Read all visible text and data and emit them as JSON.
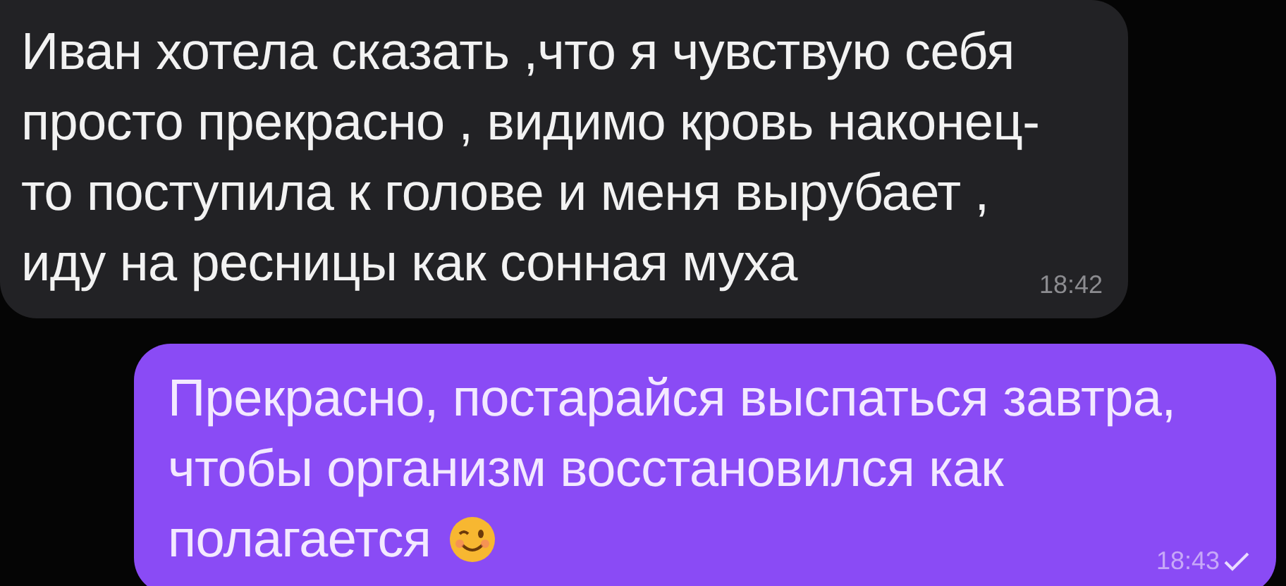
{
  "messages": [
    {
      "kind": "incoming",
      "lines": [
        "Иван хотела сказать ,что я чувствую себя",
        "просто прекрасно , видимо кровь наконец-",
        "то поступила к голове и меня вырубает ,",
        "иду на ресницы как сонная муха"
      ],
      "time": "18:42"
    },
    {
      "kind": "outgoing",
      "lines": [
        "Прекрасно, постарайся выспаться завтра,",
        "чтобы организм восстановился как",
        "полагается"
      ],
      "emoji": true,
      "time": "18:43",
      "read": false
    }
  ]
}
